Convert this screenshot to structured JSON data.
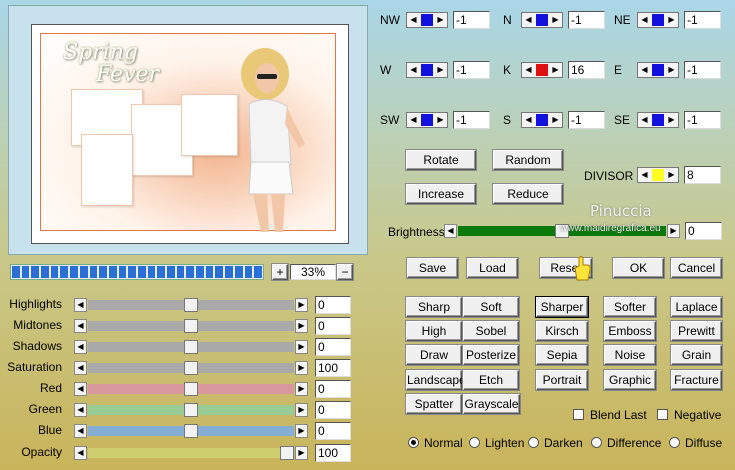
{
  "preview": {
    "title_line1": "Spring",
    "title_line2": "Fever"
  },
  "zoom": {
    "plus": "+",
    "value": "33%",
    "minus": "−"
  },
  "adjustments": [
    {
      "label": "Highlights",
      "value": "0",
      "level": 0.5,
      "track_color": "#a9a9a9"
    },
    {
      "label": "Midtones",
      "value": "0",
      "level": 0.5,
      "track_color": "#a9a9a9"
    },
    {
      "label": "Shadows",
      "value": "0",
      "level": 0.5,
      "track_color": "#a9a9a9"
    },
    {
      "label": "Saturation",
      "value": "100",
      "level": 0.5,
      "track_color": "#a9a9a9"
    },
    {
      "label": "Red",
      "value": "0",
      "level": 0.5,
      "track_color": "#d9989e"
    },
    {
      "label": "Green",
      "value": "0",
      "level": 0.5,
      "track_color": "#98cc94"
    },
    {
      "label": "Blue",
      "value": "0",
      "level": 0.5,
      "track_color": "#84aed3"
    },
    {
      "label": "Opacity",
      "value": "100",
      "level": 1.0,
      "track_color": "#cfcf6f"
    }
  ],
  "matrix": [
    {
      "label": "NW",
      "value": "-1",
      "marker": "#1111dd"
    },
    {
      "label": "N",
      "value": "-1",
      "marker": "#1111dd"
    },
    {
      "label": "NE",
      "value": "-1",
      "marker": "#1111dd"
    },
    {
      "label": "W",
      "value": "-1",
      "marker": "#1111dd"
    },
    {
      "label": "K",
      "value": "16",
      "marker": "#dd1111"
    },
    {
      "label": "E",
      "value": "-1",
      "marker": "#1111dd"
    },
    {
      "label": "SW",
      "value": "-1",
      "marker": "#1111dd"
    },
    {
      "label": "S",
      "value": "-1",
      "marker": "#1111dd"
    },
    {
      "label": "SE",
      "value": "-1",
      "marker": "#1111dd"
    }
  ],
  "matrix_buttons": {
    "rotate": "Rotate",
    "random": "Random",
    "increase": "Increase",
    "reduce": "Reduce"
  },
  "divisor": {
    "label": "DIVISOR",
    "value": "8",
    "marker": "#ffff22"
  },
  "brightness": {
    "label": "Brightness",
    "value": "0",
    "level": 0.5,
    "track_color": "#0a7a0a"
  },
  "watermark": {
    "line1": "Pinuccia",
    "line2": "www.maidiregrafica.eu"
  },
  "actions": {
    "save": "Save",
    "load": "Load",
    "reset": "Reset",
    "ok": "OK",
    "cancel": "Cancel"
  },
  "presets": [
    [
      "Sharp",
      "Soft",
      "Sharper",
      "Softer",
      "Laplace"
    ],
    [
      "High Pass",
      "Sobel",
      "Kirsch",
      "Emboss",
      "Prewitt"
    ],
    [
      "Draw",
      "Posterize",
      "Sepia",
      "Noise",
      "Grain"
    ],
    [
      "Landscape",
      "Etch",
      "Portrait",
      "Graphic",
      "Fracture"
    ],
    [
      "Spatter",
      "Grayscale"
    ]
  ],
  "selected_preset": "Sharper",
  "checkboxes": {
    "blend_last": "Blend Last",
    "negative": "Negative"
  },
  "blend_modes": {
    "options": [
      "Normal",
      "Lighten",
      "Darken",
      "Difference",
      "Diffuse"
    ],
    "selected": "Normal"
  }
}
